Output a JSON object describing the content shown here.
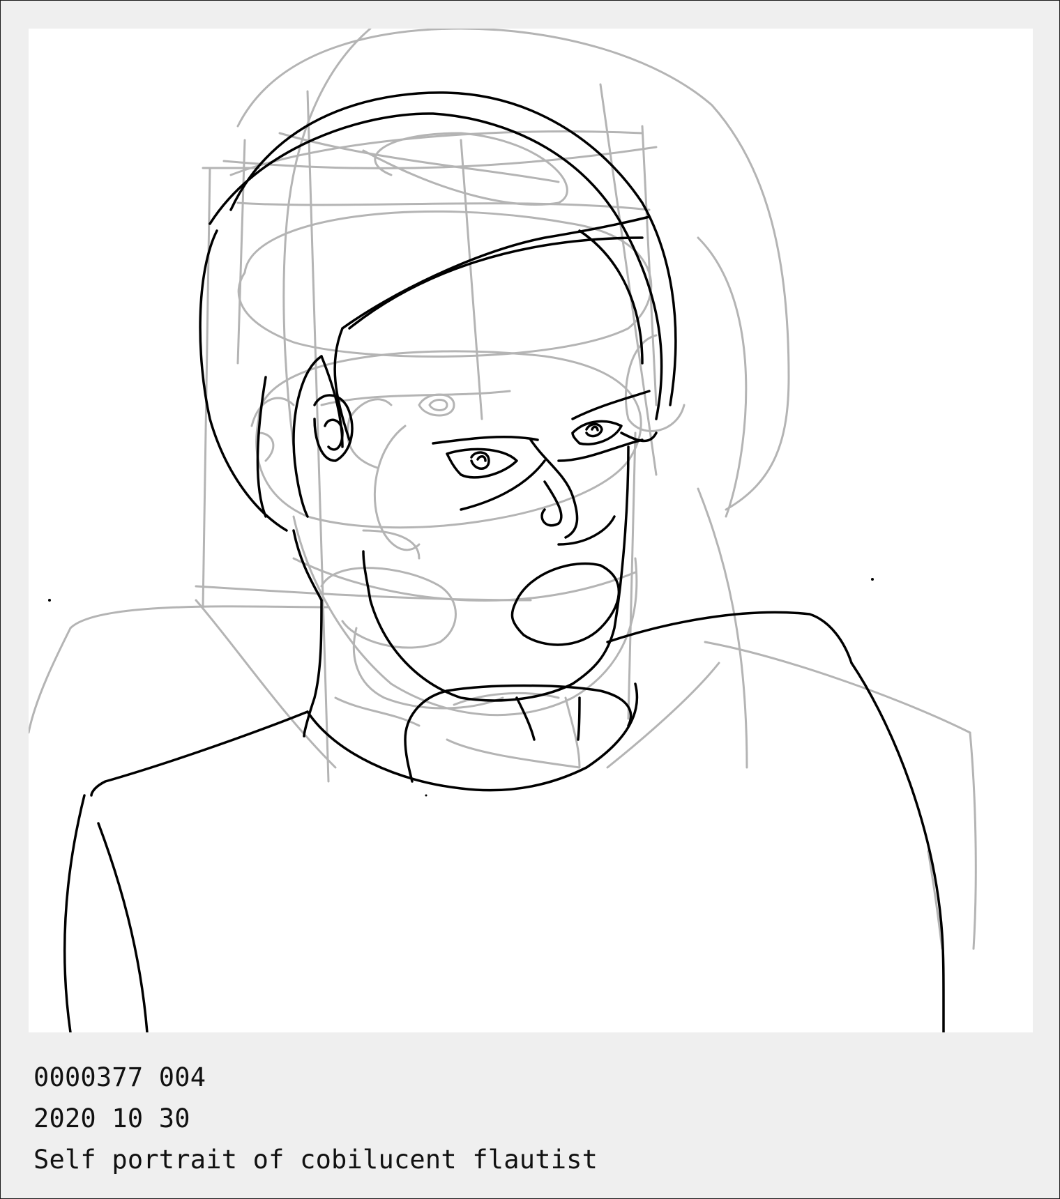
{
  "artwork": {
    "icon": "sketch-portrait",
    "stroke_colors": {
      "ink": "#000000",
      "construction": "#b4b4b4"
    },
    "background": "#ffffff",
    "frame_background": "#efefef"
  },
  "caption": {
    "id_line": "0000377 004",
    "date_line": "2020 10 30",
    "title_line": "Self portrait of cobilucent flautist"
  }
}
